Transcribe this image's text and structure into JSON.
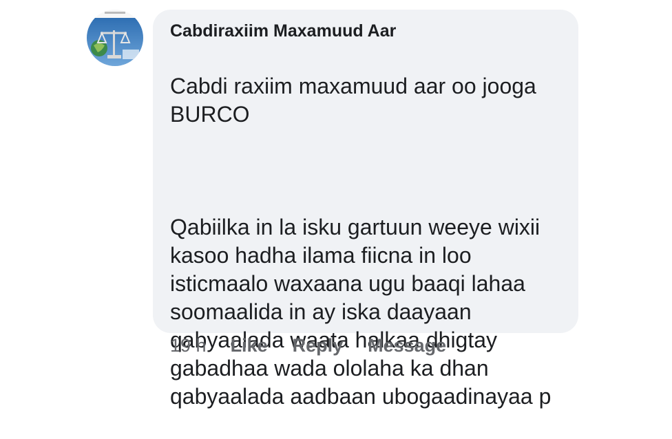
{
  "comment": {
    "author": "Cabdiraxiim Maxamuud Aar",
    "avatar_icon": "profile-photo-icon",
    "paragraphs": [
      "Cabdi raxiim maxamuud aar oo jooga\nBURCO",
      "Qabiilka in la isku gartuun weeye wixii\nkasoo hadha ilama fiicna in loo\nisticmaalo waxaana ugu baaqi lahaa\nsoomaalida in ay iska daayaan\nqabyaalada waata halkaa dhigtay\ngabadhaa wada ololaha ka dhan\nqabyaalada aadbaan ubogaadinayaa p"
    ],
    "bubble_color": "#f0f2f5"
  },
  "actions": {
    "time": "19 h",
    "like": "Like",
    "reply": "Reply",
    "message": "Message"
  }
}
